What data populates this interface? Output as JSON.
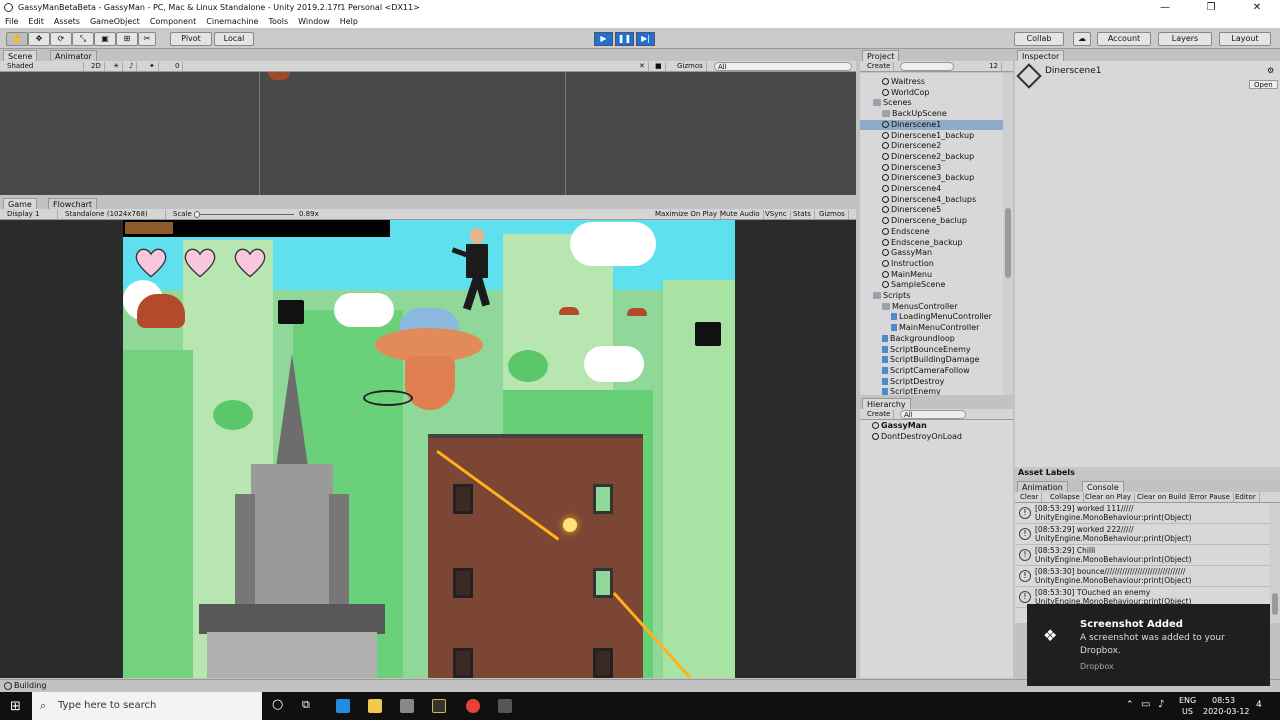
{
  "window": {
    "title": "GassyManBetaBeta - GassyMan - PC, Mac & Linux Standalone - Unity 2019.2.17f1 Personal <DX11>",
    "minimize": "—",
    "maximize": "❐",
    "close": "✕"
  },
  "menu": [
    "File",
    "Edit",
    "Assets",
    "GameObject",
    "Component",
    "Cinemachine",
    "Tools",
    "Window",
    "Help"
  ],
  "toolbar": {
    "pivot": "Pivot",
    "local": "Local",
    "collab": "Collab",
    "account": "Account",
    "layers": "Layers",
    "layout": "Layout",
    "play_color": "#1f6fd6"
  },
  "scene_panel": {
    "tab_scene": "Scene",
    "tab_animator": "Animator",
    "shaded": "Shaded",
    "mode_2d": "2D",
    "gizmos": "Gizmos",
    "search_all": "All",
    "hidden_count": "0"
  },
  "game_panel": {
    "tab_game": "Game",
    "tab_flowchart": "Flowchart",
    "display": "Display 1",
    "resolution": "Standalone (1024x768)",
    "scale_label": "Scale",
    "scale_value": "0.89x",
    "maximize_on_play": "Maximize On Play",
    "mute_audio": "Mute Audio",
    "vsync": "VSync",
    "stats": "Stats",
    "gizmos": "Gizmos",
    "sky_color": "#5ee0ee",
    "hearts": 3
  },
  "project_panel": {
    "tab": "Project",
    "create": "Create",
    "filter_count": "12",
    "items": [
      {
        "label": "Waitress",
        "type": "unity",
        "indent": 2
      },
      {
        "label": "WorldCop",
        "type": "unity",
        "indent": 2
      },
      {
        "label": "Scenes",
        "type": "folder",
        "indent": 1
      },
      {
        "label": "BackUpScene",
        "type": "folder",
        "indent": 2
      },
      {
        "label": "Dinerscene1",
        "type": "unity",
        "indent": 2,
        "selected": true
      },
      {
        "label": "Dinerscene1_backup",
        "type": "unity",
        "indent": 2
      },
      {
        "label": "Dinerscene2",
        "type": "unity",
        "indent": 2
      },
      {
        "label": "Dinerscene2_backup",
        "type": "unity",
        "indent": 2
      },
      {
        "label": "Dinerscene3",
        "type": "unity",
        "indent": 2
      },
      {
        "label": "Dinerscene3_backup",
        "type": "unity",
        "indent": 2
      },
      {
        "label": "Dinerscene4",
        "type": "unity",
        "indent": 2
      },
      {
        "label": "Dinerscene4_baclups",
        "type": "unity",
        "indent": 2
      },
      {
        "label": "Dinerscene5",
        "type": "unity",
        "indent": 2
      },
      {
        "label": "Dinerscene_baclup",
        "type": "unity",
        "indent": 2
      },
      {
        "label": "Endscene",
        "type": "unity",
        "indent": 2
      },
      {
        "label": "Endscene_backup",
        "type": "unity",
        "indent": 2
      },
      {
        "label": "GassyMan",
        "type": "unity",
        "indent": 2
      },
      {
        "label": "Instruction",
        "type": "unity",
        "indent": 2
      },
      {
        "label": "MainMenu",
        "type": "unity",
        "indent": 2
      },
      {
        "label": "SampleScene",
        "type": "unity",
        "indent": 2
      },
      {
        "label": "Scripts",
        "type": "folder",
        "indent": 1
      },
      {
        "label": "MenusController",
        "type": "folder",
        "indent": 2
      },
      {
        "label": "LoadingMenuController",
        "type": "script",
        "indent": 3
      },
      {
        "label": "MainMenuController",
        "type": "script",
        "indent": 3
      },
      {
        "label": "Backgroundloop",
        "type": "script",
        "indent": 2
      },
      {
        "label": "ScriptBounceEnemy",
        "type": "script",
        "indent": 2
      },
      {
        "label": "ScriptBuildingDamage",
        "type": "script",
        "indent": 2
      },
      {
        "label": "ScriptCameraFollow",
        "type": "script",
        "indent": 2
      },
      {
        "label": "ScriptDestroy",
        "type": "script",
        "indent": 2
      },
      {
        "label": "ScriptEnemy",
        "type": "script",
        "indent": 2
      }
    ]
  },
  "hierarchy_panel": {
    "tab": "Hierarchy",
    "create": "Create",
    "search_all": "All",
    "items": [
      "GassyMan",
      "DontDestroyOnLoad"
    ]
  },
  "inspector": {
    "tab": "Inspector",
    "asset_name": "Dinerscene1",
    "open": "Open",
    "asset_labels": "Asset Labels"
  },
  "console": {
    "tab_animation": "Animation",
    "tab_console": "Console",
    "buttons": [
      "Clear",
      "Collapse",
      "Clear on Play",
      "Clear on Build",
      "Error Pause",
      "Editor"
    ],
    "logs": [
      {
        "line1": "[08:53:29] worked 111/////",
        "line2": "UnityEngine.MonoBehaviour:print(Object)"
      },
      {
        "line1": "[08:53:29] worked 222/////",
        "line2": "UnityEngine.MonoBehaviour:print(Object)"
      },
      {
        "line1": "[08:53:29] Chilli",
        "line2": "UnityEngine.MonoBehaviour:print(Object)"
      },
      {
        "line1": "[08:53:30] bounce////////////////////////////////",
        "line2": "UnityEngine.MonoBehaviour:print(Object)"
      },
      {
        "line1": "[08:53:30] TOuched an enemy",
        "line2": "UnityEngine.MonoBehaviour:print(Object)"
      }
    ]
  },
  "status": {
    "text": "Building"
  },
  "toast": {
    "title": "Screenshot Added",
    "body": "A screenshot was added to your Dropbox.",
    "source": "Dropbox"
  },
  "taskbar": {
    "search_placeholder": "Type here to search",
    "language": "ENG",
    "region": "US",
    "time": "08:53",
    "date": "2020-03-12",
    "notifications": "4"
  }
}
